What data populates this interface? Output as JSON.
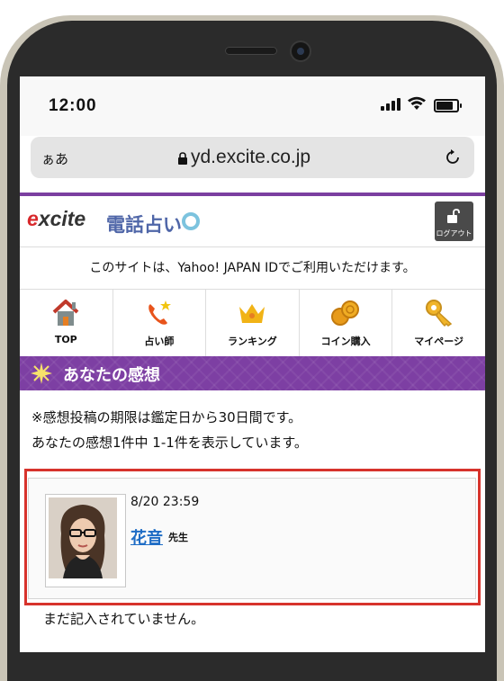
{
  "status_bar": {
    "time": "12:00"
  },
  "browser": {
    "text_size_label": "ぁあ",
    "url": "yd.excite.co.jp"
  },
  "site_header": {
    "logo_text": "excite",
    "logo_subtitle": "電話占い",
    "logout_label": "ログアウト"
  },
  "notice": "このサイトは、Yahoo! JAPAN IDでご利用いただけます。",
  "nav": {
    "items": [
      {
        "label": "TOP",
        "icon": "home-icon"
      },
      {
        "label": "占い師",
        "icon": "phone-star-icon"
      },
      {
        "label": "ランキング",
        "icon": "crown-icon"
      },
      {
        "label": "コイン購入",
        "icon": "coins-icon"
      },
      {
        "label": "マイページ",
        "icon": "key-icon"
      }
    ]
  },
  "section": {
    "title": "あなたの感想"
  },
  "info": {
    "line1": "※感想投稿の期限は鑑定日から30日間です。",
    "line2": "あなたの感想1件中 1-1件を表示しています。"
  },
  "review": {
    "date": "8/20 23:59",
    "fortune_teller": "花音",
    "honorific": "先生",
    "comment": "まだ記入されていません。"
  },
  "colors": {
    "accent_purple": "#7d3fa3",
    "highlight_red": "#d7332c",
    "link_blue": "#1e6cc5"
  }
}
